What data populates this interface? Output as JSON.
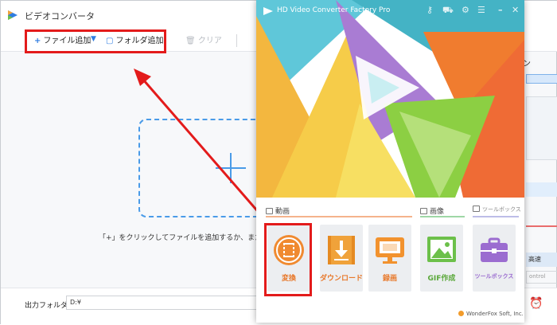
{
  "background_window": {
    "title": "ビデオコンバータ",
    "toolbar": {
      "add_file": "ファイル追加",
      "add_folder": "フォルダ追加",
      "clear": "クリア"
    },
    "hint": "「+」をクリックしてファイルを追加するか、またはフ",
    "output_folder_label": "出力フォルダ：",
    "output_folder_value": "D:¥",
    "right_edge": {
      "letter": "ン",
      "button1": "高速",
      "button2": "ontrol"
    }
  },
  "front_window": {
    "title": "HD Video Converter Factory Pro",
    "sections": {
      "video": "動画",
      "image": "画像",
      "tools": "ツールボックス"
    },
    "tiles": [
      {
        "label": "変換",
        "icon": "film-convert-icon"
      },
      {
        "label": "ダウンロード",
        "icon": "download-icon"
      },
      {
        "label": "録画",
        "icon": "screen-record-icon"
      },
      {
        "label": "GIF作成",
        "icon": "gif-image-icon"
      },
      {
        "label": "ツールボックス",
        "icon": "toolbox-icon"
      }
    ],
    "brand": "WonderFox Soft, Inc."
  },
  "colors": {
    "highlight": "#e31b1b",
    "accent_blue": "#2f7de1",
    "convert_orange": "#f08a30",
    "download_orange": "#f0a23a",
    "record_orange": "#f2922e",
    "gif_green": "#6cc04a",
    "toolbox_purple": "#9b6cd0"
  }
}
